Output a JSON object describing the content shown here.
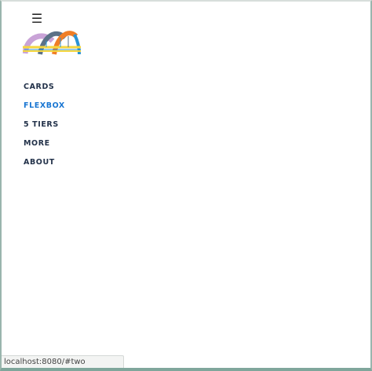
{
  "header": {
    "menu_icon_glyph": "☰",
    "menu_icon_name": "hamburger-menu-icon",
    "logo_icon_name": "bridge-logo-icon",
    "logo_colors": {
      "lavender": "#c9a3d7",
      "slate": "#5b7187",
      "orange": "#f07e26",
      "blue": "#2a93d5",
      "yellow": "#f5d63d"
    }
  },
  "nav": {
    "items": [
      {
        "label": "CARDS",
        "active": false
      },
      {
        "label": "FLEXBOX",
        "active": true
      },
      {
        "label": "5 TIERS",
        "active": false
      },
      {
        "label": "MORE",
        "active": false
      },
      {
        "label": "ABOUT",
        "active": false
      }
    ],
    "colors": {
      "default": "#23324a",
      "active": "#1976d2"
    }
  },
  "status_bar": {
    "url": "localhost:8080/#two"
  }
}
